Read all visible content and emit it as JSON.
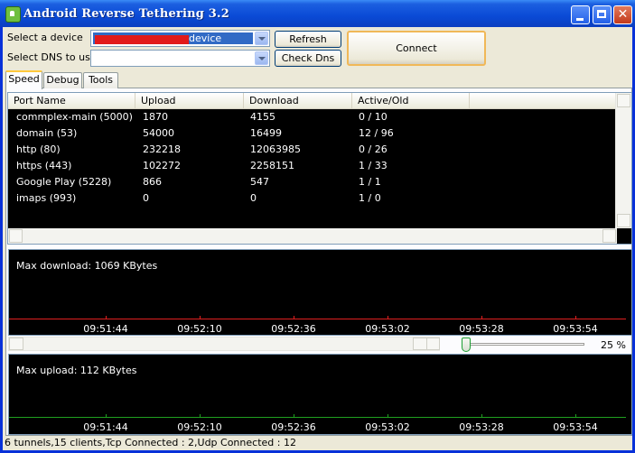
{
  "window": {
    "title": "Android Reverse Tethering 3.2",
    "colors": {
      "titlebar": "#0a4ad6",
      "panel": "#ece9d8",
      "graph_bg": "#000000",
      "download_line": "#e02020",
      "upload_line": "#20a020"
    }
  },
  "controls": {
    "device_label": "Select a device",
    "device_value": "device",
    "dns_label": "Select DNS to use",
    "dns_value": "",
    "refresh_label": "Refresh",
    "check_dns_label": "Check Dns",
    "connect_label": "Connect"
  },
  "tabs": [
    {
      "label": "Speed",
      "active": true
    },
    {
      "label": "Debug",
      "active": false
    },
    {
      "label": "Tools",
      "active": false
    }
  ],
  "table": {
    "columns": [
      "Port Name",
      "Upload",
      "Download",
      "Active/Old Connections"
    ],
    "rows": [
      [
        "commplex-main (5000)",
        "1870",
        "4155",
        "0 / 10"
      ],
      [
        "domain (53)",
        "54000",
        "16499",
        "12 / 96"
      ],
      [
        "http (80)",
        "232218",
        "12063985",
        "0 / 26"
      ],
      [
        "https (443)",
        "102272",
        "2258151",
        "1 / 33"
      ],
      [
        "Google Play (5228)",
        "866",
        "547",
        "1 / 1"
      ],
      [
        "imaps (993)",
        "0",
        "0",
        "1 / 0"
      ]
    ]
  },
  "download_graph": {
    "caption": "Max download: 1069 KBytes",
    "times": [
      "09:51:44",
      "09:52:10",
      "09:52:36",
      "09:53:02",
      "09:53:28",
      "09:53:54"
    ]
  },
  "upload_graph": {
    "caption": "Max upload: 112 KBytes",
    "times": [
      "09:51:44",
      "09:52:10",
      "09:52:36",
      "09:53:02",
      "09:53:28",
      "09:53:54"
    ]
  },
  "zoom": {
    "label": "25 %",
    "value_percent": 25
  },
  "status": {
    "text": "6 tunnels,15 clients,Tcp Connected : 2,Udp Connected : 12"
  }
}
